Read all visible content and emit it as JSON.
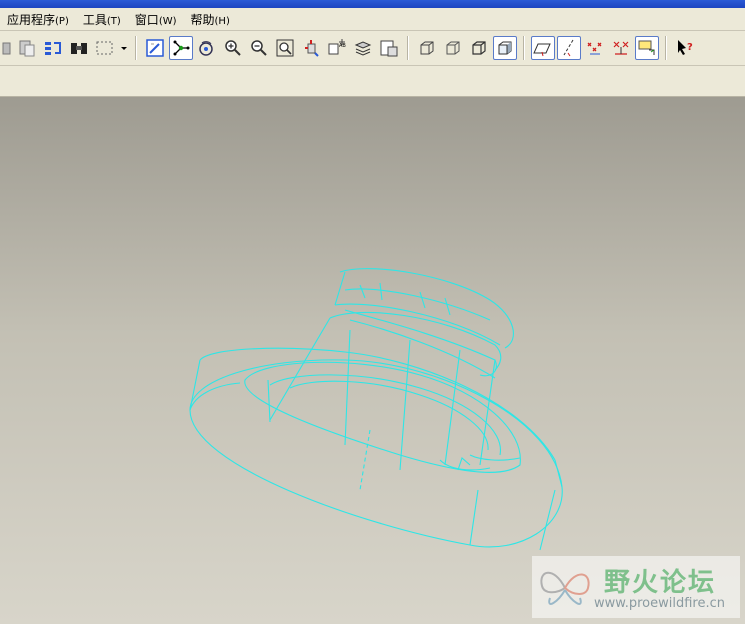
{
  "menu": [
    {
      "label": "应用程序",
      "key": "(P)"
    },
    {
      "label": "工具",
      "key": "(T)"
    },
    {
      "label": "窗口",
      "key": "(W)"
    },
    {
      "label": "帮助",
      "key": "(H)"
    }
  ],
  "toolbar_icons": [
    "paste-icon",
    "paste-special-icon",
    "regenerate-icon",
    "find-icon",
    "select-box-icon",
    "dropdown-arrow-icon",
    "repaint-icon",
    "spin-center-icon",
    "orient-mode-icon",
    "zoom-in-icon",
    "zoom-out-icon",
    "refit-icon",
    "reorient-icon",
    "saved-views-icon",
    "layers-icon",
    "view-manager-icon",
    "wireframe-icon",
    "hidden-line-icon",
    "no-hidden-icon",
    "shading-icon",
    "datum-planes-icon",
    "datum-axes-icon",
    "datum-points-icon",
    "csys-icon",
    "annotations-icon",
    "context-help-icon"
  ],
  "watermark": {
    "title": "野火论坛",
    "url": "www.proewildfire.cn"
  },
  "colors": {
    "wireframe": "#2ee6e6",
    "watermark_text": "#7fc08c"
  }
}
